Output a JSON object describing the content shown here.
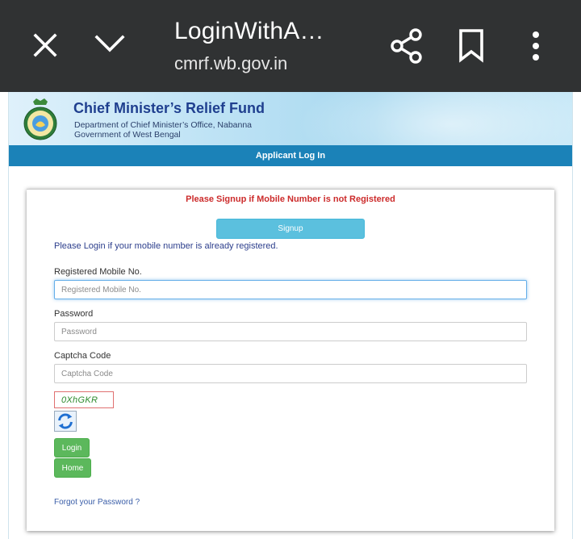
{
  "browser": {
    "title": "LoginWithA…",
    "url": "cmrf.wb.gov.in"
  },
  "header": {
    "title": "Chief Minister’s Relief Fund",
    "subtitle_line1": "Department of Chief Minister’s Office, Nabanna",
    "subtitle_line2": "Government of West Bengal"
  },
  "section_title": "Applicant Log In",
  "form": {
    "signup_warning": "Please Signup if Mobile Number is not Registered",
    "signup_label": "Signup",
    "login_note": "Please Login if your mobile number is already registered.",
    "mobile": {
      "label": "Registered Mobile No.",
      "placeholder": "Registered Mobile No.",
      "value": ""
    },
    "password": {
      "label": "Password",
      "placeholder": "Password",
      "value": ""
    },
    "captcha": {
      "label": "Captcha Code",
      "placeholder": "Captcha Code",
      "value": "",
      "image_text": "0XhGKR"
    },
    "login_label": "Login",
    "home_label": "Home",
    "forgot_label": "Forgot your Password ?"
  },
  "colors": {
    "toolbar_bg": "#303233",
    "section_bar": "#1b82b8",
    "header_title": "#1f3f8f",
    "warning_text": "#cc2b2b",
    "signup_button": "#5bc0de",
    "green_button": "#5cb85c",
    "captcha_text": "#2e8b2e"
  },
  "icons": {
    "close": "close-icon",
    "chevron": "chevron-down-icon",
    "share": "share-icon",
    "bookmark": "bookmark-icon",
    "more": "more-vert-icon",
    "emblem": "state-emblem-icon",
    "refresh": "refresh-captcha-icon"
  }
}
